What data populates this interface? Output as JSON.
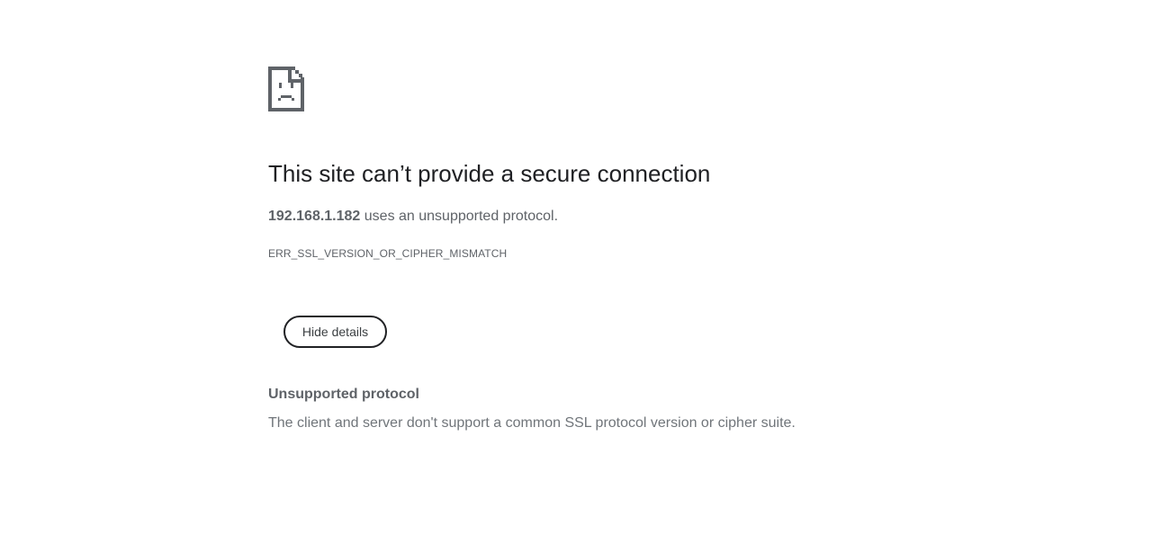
{
  "icon": "sad-document-icon",
  "colors": {
    "icon": "#5f6368",
    "heading": "#202124",
    "text": "#5f6368",
    "secondary_text": "#70757a",
    "button_border": "#202124"
  },
  "main": {
    "heading": "This site can’t provide a secure connection",
    "host": "192.168.1.182",
    "message_suffix": " uses an unsupported protocol.",
    "error_code": "ERR_SSL_VERSION_OR_CIPHER_MISMATCH"
  },
  "details_button": {
    "label": "Hide details"
  },
  "details": {
    "heading": "Unsupported protocol",
    "text": "The client and server don't support a common SSL protocol version or cipher suite."
  }
}
